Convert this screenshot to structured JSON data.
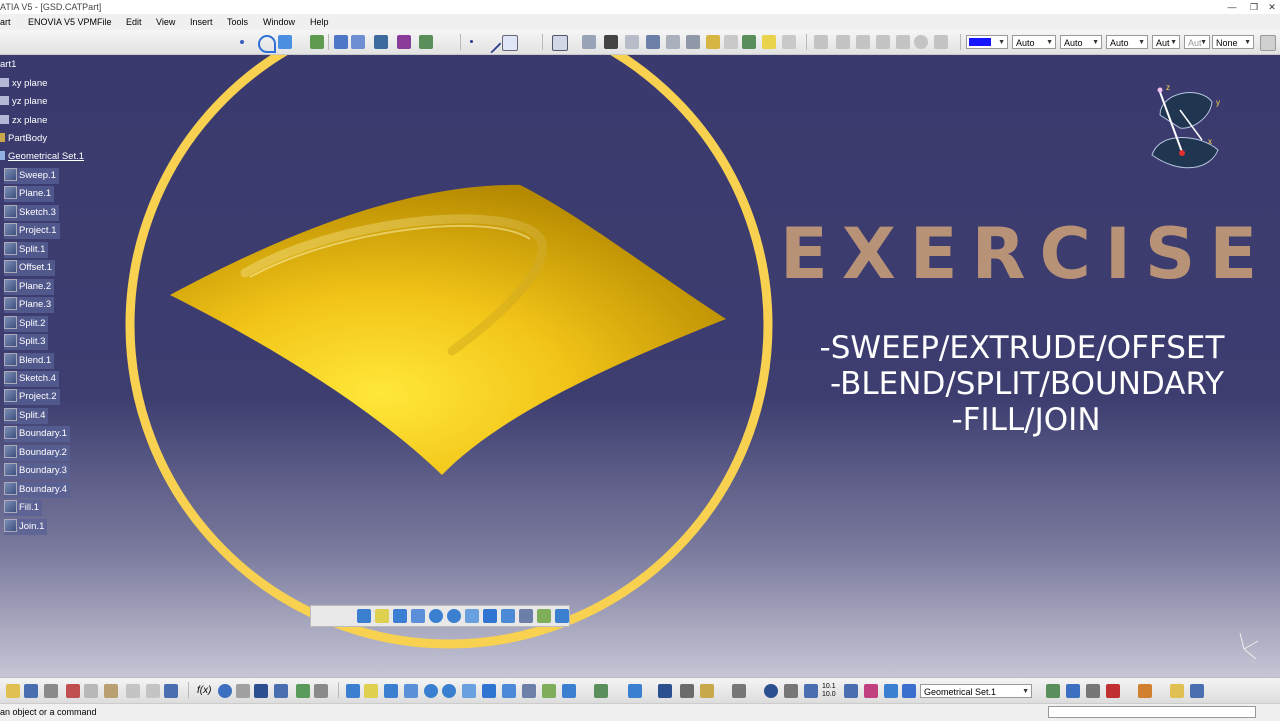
{
  "window": {
    "title": "ATIA V5 - [GSD.CATPart]",
    "minimize_glyph": "—",
    "restore_glyph": "❐",
    "close_glyph": "✕"
  },
  "menu": {
    "items": [
      "art",
      "ENOVIA V5 VPM",
      "File",
      "Edit",
      "View",
      "Insert",
      "Tools",
      "Window",
      "Help"
    ]
  },
  "properties_toolbar": {
    "color_value": "#1515ff",
    "linetype": "Auto",
    "thickness": "Auto",
    "linestyle": "Auto",
    "layer": "Aut",
    "render": "Aut",
    "layer_filter": "None"
  },
  "tree": {
    "root": "art1",
    "planes": [
      "xy plane",
      "yz plane",
      "zx plane"
    ],
    "body": "PartBody",
    "geometrical_set": "Geometrical Set.1",
    "features": [
      "Sweep.1",
      "Plane.1",
      "Sketch.3",
      "Project.1",
      "Split.1",
      "Offset.1",
      "Plane.2",
      "Plane.3",
      "Split.2",
      "Split.3",
      "Blend.1",
      "Sketch.4",
      "Project.2",
      "Split.4",
      "Boundary.1",
      "Boundary.2",
      "Boundary.3",
      "Boundary.4",
      "Fill.1",
      "Join.1"
    ]
  },
  "compass": {
    "axis_labels": [
      "z",
      "y",
      "x"
    ]
  },
  "overlay": {
    "title": "EXERCISE",
    "lines": [
      "-SWEEP/EXTRUDE/OFFSET",
      "-BLEND/SPLIT/BOUNDARY",
      "-FILL/JOIN"
    ],
    "text_color": "#b89277",
    "circle_color": "#f7d14f"
  },
  "surface": {
    "color_light": "#ffe83a",
    "color_dark": "#b48800"
  },
  "bottom_toolbar": {
    "current_set": "Geometrical Set.1",
    "fx_label": "f(x)",
    "grid_label": "10.1 10.0"
  },
  "status": {
    "prompt": "an object or a command",
    "command_value": ""
  },
  "colors": {
    "background_top": "#3a3a6e",
    "background_bottom": "#c6c6d6",
    "tree_highlight": "#5862a0"
  }
}
